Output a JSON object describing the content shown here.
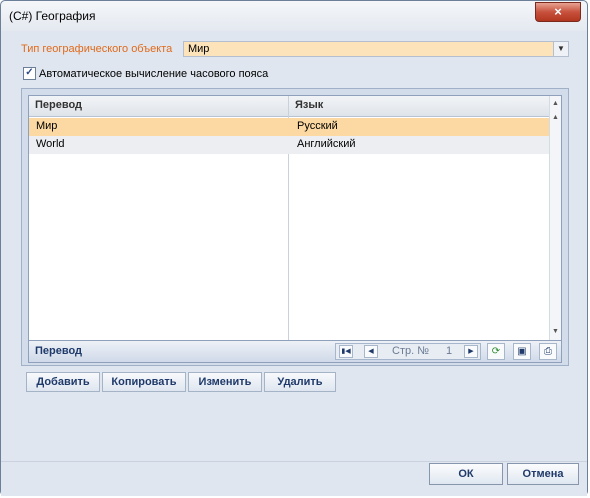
{
  "window": {
    "title": "(C#) География",
    "close_glyph": "×"
  },
  "type_field": {
    "label": "Тип географического объекта",
    "value": "Мир"
  },
  "auto_tz": {
    "label": "Автоматическое вычисление часового пояса",
    "checked": true,
    "check_glyph": "✓"
  },
  "grid": {
    "columns": [
      "Перевод",
      "Язык"
    ],
    "rows": [
      {
        "translation": "Мир",
        "language": "Русский",
        "selected": true
      },
      {
        "translation": "World",
        "language": "Английский",
        "selected": false
      }
    ],
    "footer_title": "Перевод",
    "page_label": "Стр. №",
    "page_number": "1",
    "icons": [
      "first-page-icon",
      "prev-page-icon",
      "next-page-icon",
      "refresh-icon",
      "save-icon",
      "print-icon"
    ]
  },
  "actions": {
    "add": "Добавить",
    "copy": "Копировать",
    "edit": "Изменить",
    "delete": "Удалить"
  },
  "dialog": {
    "ok": "ОК",
    "cancel": "Отмена"
  },
  "colors": {
    "label_orange": "#e26a1b",
    "selected_row": "#fcd8a2",
    "select_bg": "#fde3b9"
  }
}
